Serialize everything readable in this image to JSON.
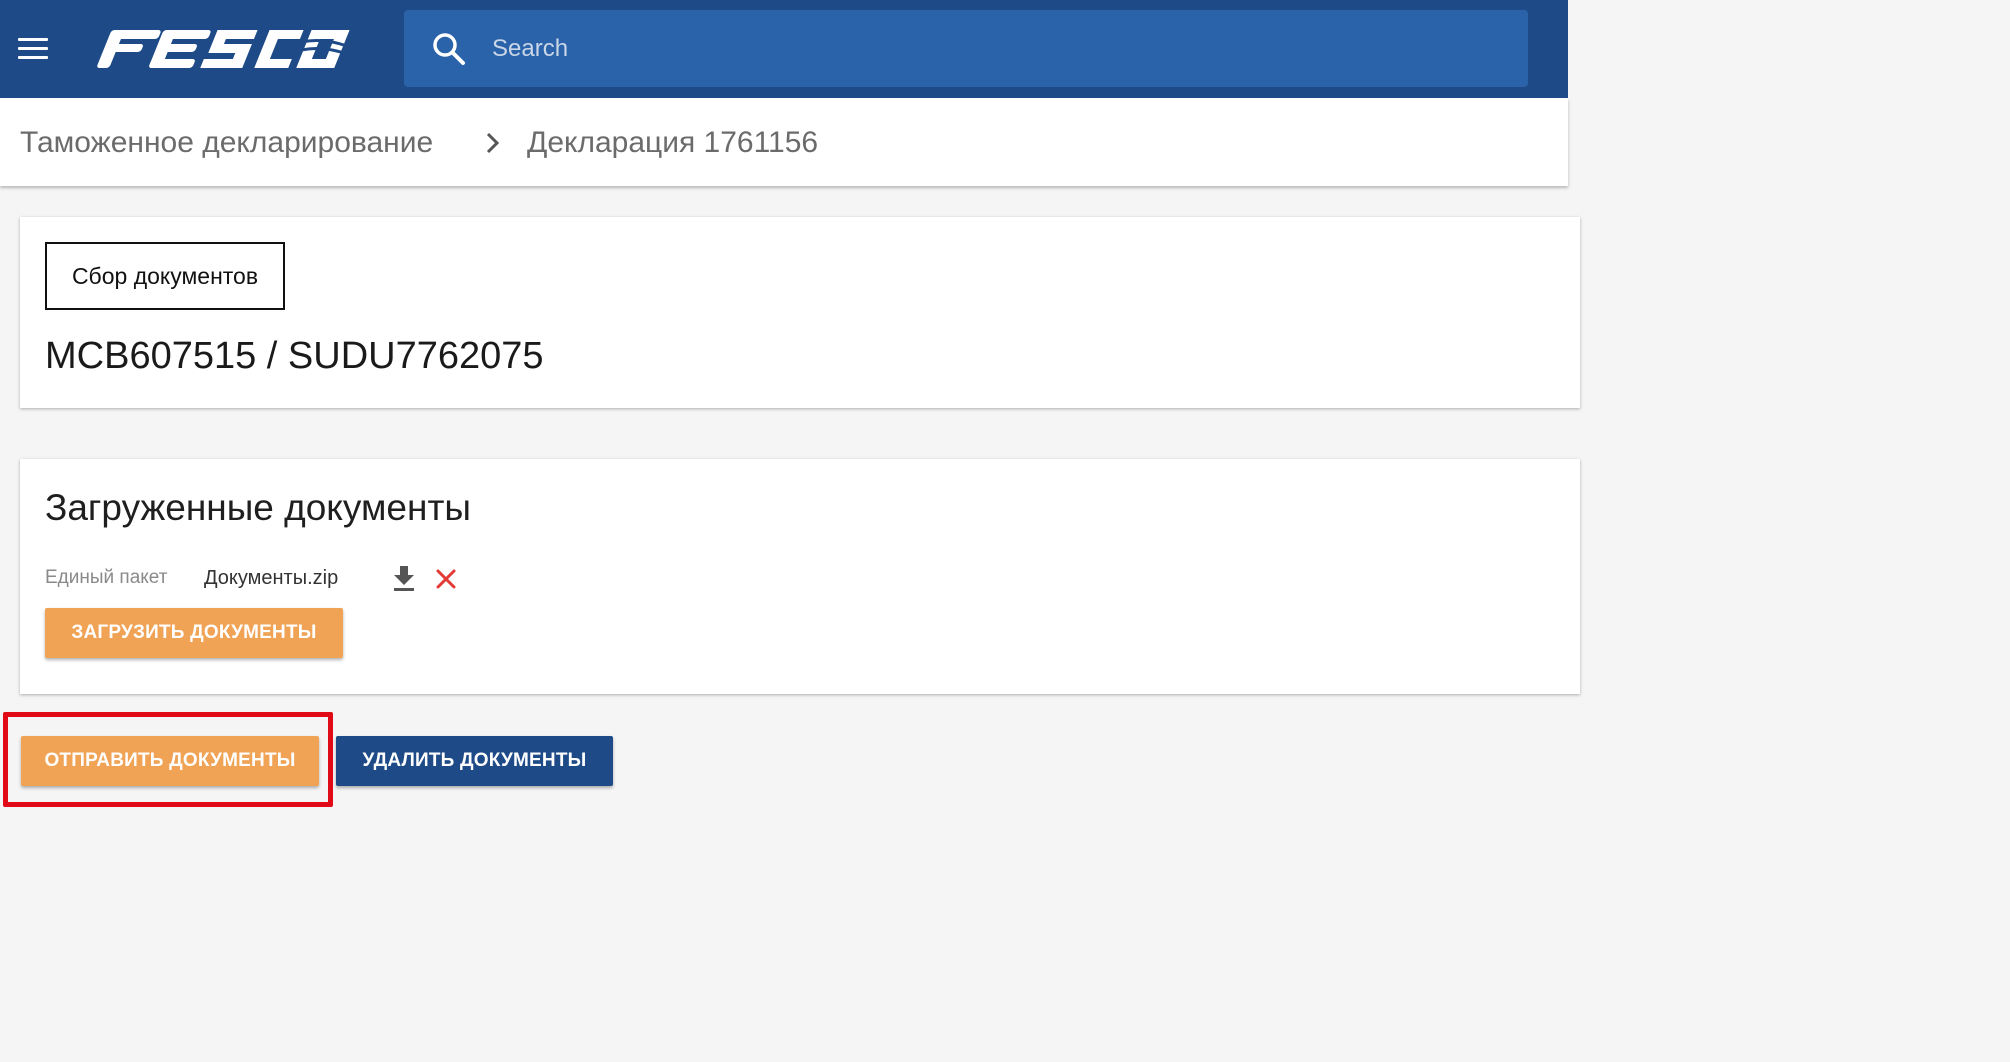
{
  "header": {
    "brand": "FESCO",
    "search_placeholder": "Search"
  },
  "breadcrumb": {
    "parent": "Таможенное декларирование",
    "current": "Декларация 1761156"
  },
  "shipment_card": {
    "stage": "Сбор документов",
    "bl_container": "MCB607515 / SUDU7762075"
  },
  "documents_card": {
    "title": "Загруженные документы",
    "documents": [
      {
        "type": "Единый пакет",
        "file": "Документы.zip"
      }
    ],
    "upload_label": "ЗАГРУЗИТЬ ДОКУМЕНТЫ"
  },
  "actions": {
    "send_label": "ОТПРАВИТЬ ДОКУМЕНТЫ",
    "delete_label": "УДАЛИТЬ ДОКУМЕНТЫ"
  },
  "colors": {
    "header": "#1e4b87",
    "search": "#2a63a9",
    "accent_orange": "#f0a255",
    "navy_button": "#1e4b87",
    "delete_icon": "#e53935",
    "highlight": "#e00b16"
  },
  "icons": {
    "menu": "hamburger-menu-icon",
    "search": "search-icon",
    "breadcrumb_separator": "chevron-right-icon",
    "download": "download-icon",
    "delete": "close-icon"
  }
}
